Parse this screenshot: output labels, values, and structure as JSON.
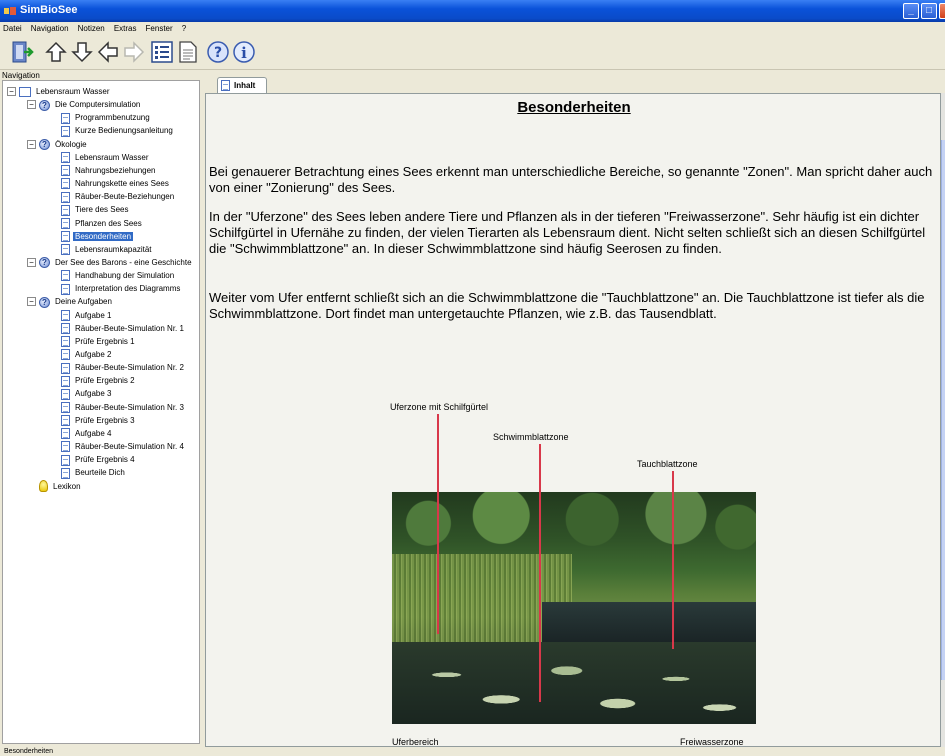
{
  "window": {
    "title": "SimBioSee"
  },
  "menu": [
    "Datei",
    "Navigation",
    "Notizen",
    "Extras",
    "Fenster",
    "?"
  ],
  "toolbar": [
    "exit-icon",
    "arrow-up-icon",
    "arrow-down-icon",
    "arrow-left-icon",
    "arrow-right-icon",
    "list-icon",
    "page-icon",
    "help-icon",
    "info-icon"
  ],
  "navigation": {
    "label": "Navigation",
    "tree": [
      {
        "label": "Lebensraum Wasser",
        "level": 0,
        "icon": "root"
      },
      {
        "label": "Die Computersimulation",
        "level": 1,
        "icon": "book"
      },
      {
        "label": "Programmbenutzung",
        "level": 2,
        "icon": "page"
      },
      {
        "label": "Kurze Bedienungsanleitung",
        "level": 2,
        "icon": "page"
      },
      {
        "label": "Ökologie",
        "level": 1,
        "icon": "book"
      },
      {
        "label": "Lebensraum Wasser",
        "level": 2,
        "icon": "page"
      },
      {
        "label": "Nahrungsbeziehungen",
        "level": 2,
        "icon": "page"
      },
      {
        "label": "Nahrungskette eines Sees",
        "level": 2,
        "icon": "page"
      },
      {
        "label": "Räuber-Beute-Beziehungen",
        "level": 2,
        "icon": "page"
      },
      {
        "label": "Tiere des Sees",
        "level": 2,
        "icon": "page"
      },
      {
        "label": "Pflanzen des Sees",
        "level": 2,
        "icon": "page"
      },
      {
        "label": "Besonderheiten",
        "level": 2,
        "icon": "page",
        "selected": true
      },
      {
        "label": "Lebensraumkapazität",
        "level": 2,
        "icon": "page"
      },
      {
        "label": "Der See des Barons - eine Geschichte",
        "level": 1,
        "icon": "book"
      },
      {
        "label": "Handhabung der Simulation",
        "level": 2,
        "icon": "page"
      },
      {
        "label": "Interpretation des Diagramms",
        "level": 2,
        "icon": "page"
      },
      {
        "label": "Deine Aufgaben",
        "level": 1,
        "icon": "book"
      },
      {
        "label": "Aufgabe 1",
        "level": 2,
        "icon": "page"
      },
      {
        "label": "Räuber-Beute-Simulation Nr. 1",
        "level": 2,
        "icon": "page"
      },
      {
        "label": "Prüfe Ergebnis 1",
        "level": 2,
        "icon": "page"
      },
      {
        "label": "Aufgabe 2",
        "level": 2,
        "icon": "page"
      },
      {
        "label": "Räuber-Beute-Simulation Nr. 2",
        "level": 2,
        "icon": "page"
      },
      {
        "label": "Prüfe Ergebnis 2",
        "level": 2,
        "icon": "page"
      },
      {
        "label": "Aufgabe 3",
        "level": 2,
        "icon": "page"
      },
      {
        "label": "Räuber-Beute-Simulation Nr. 3",
        "level": 2,
        "icon": "page"
      },
      {
        "label": "Prüfe Ergebnis 3",
        "level": 2,
        "icon": "page"
      },
      {
        "label": "Aufgabe 4",
        "level": 2,
        "icon": "page"
      },
      {
        "label": "Räuber-Beute-Simulation Nr. 4",
        "level": 2,
        "icon": "page"
      },
      {
        "label": "Prüfe Ergebnis 4",
        "level": 2,
        "icon": "page"
      },
      {
        "label": "Beurteile Dich",
        "level": 2,
        "icon": "page"
      },
      {
        "label": "Lexikon",
        "level": 1,
        "icon": "bulb"
      }
    ]
  },
  "tabs": [
    {
      "label": "Inhalt"
    }
  ],
  "content": {
    "heading": "Besonderheiten",
    "paragraphs": [
      "Bei genauerer Betrachtung eines Sees erkennt man unterschiedliche Bereiche, so genannte \"Zonen\". Man spricht daher auch von einer \"Zonierung\" des Sees.",
      "In der \"Uferzone\" des Sees leben andere Tiere und Pflanzen als in der tieferen \"Freiwasserzone\". Sehr häufig ist ein dichter Schilfgürtel in Ufernähe zu finden, der vielen Tierarten als Lebensraum dient. Nicht selten schließt sich an diesen Schilfgürtel die \"Schwimmblattzone\" an. In dieser Schwimmblattzone sind häufig Seerosen zu finden.",
      "Weiter vom Ufer entfernt schließt sich an die Schwimmblattzone die \"Tauchblattzone\" an. Die Tauchblattzone ist tiefer als die Schwimmblattzone. Dort findet man untergetauchte Pflanzen, wie z.B. das Tausendblatt."
    ],
    "figure": {
      "labels": {
        "uferzone": "Uferzone mit Schilfgürtel",
        "schwimmblatt": "Schwimmblattzone",
        "tauchblatt": "Tauchblattzone",
        "uferbereich": "Uferbereich",
        "freiwasser": "Freiwasserzone"
      }
    }
  },
  "status": {
    "text": "Besonderheiten"
  },
  "colors": {
    "titlebar": "#0a52d9",
    "selection": "#316ac5",
    "zone_line": "#d8384a"
  }
}
